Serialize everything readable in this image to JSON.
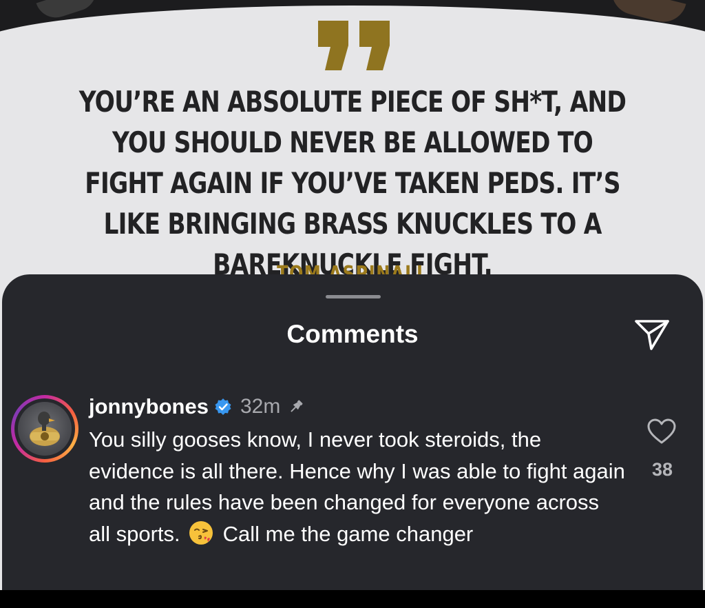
{
  "quote": {
    "text": "YOU’RE AN ABSOLUTE PIECE OF SH*T, AND YOU SHOULD NEVER BE ALLOWED TO FIGHT AGAIN IF YOU’VE TAKEN PEDS. IT’S LIKE BRINGING BRASS KNUCKLES TO A BAREKNUCKLE FIGHT.",
    "author": "TOM ASPINALL",
    "accent_color": "#8f7420"
  },
  "sheet": {
    "title": "Comments",
    "share_icon": "share-icon"
  },
  "comment": {
    "username": "jonnybones",
    "verified_icon": "verified-badge-icon",
    "time": "32m",
    "pin_icon": "pin-icon",
    "text_before_emoji": "You silly gooses know, I never took steroids, the evidence is all there. Hence why I was able to fight again and the rules have been changed for everyone across all sports.",
    "emoji": "face-blowing-kiss-icon",
    "text_after_emoji": "Call me the game changer",
    "like_icon": "heart-icon",
    "like_count": "38"
  },
  "colors": {
    "sheet_background": "#26272c",
    "verified_blue": "#3897f0",
    "avatar_ring": "#c32aa3"
  }
}
